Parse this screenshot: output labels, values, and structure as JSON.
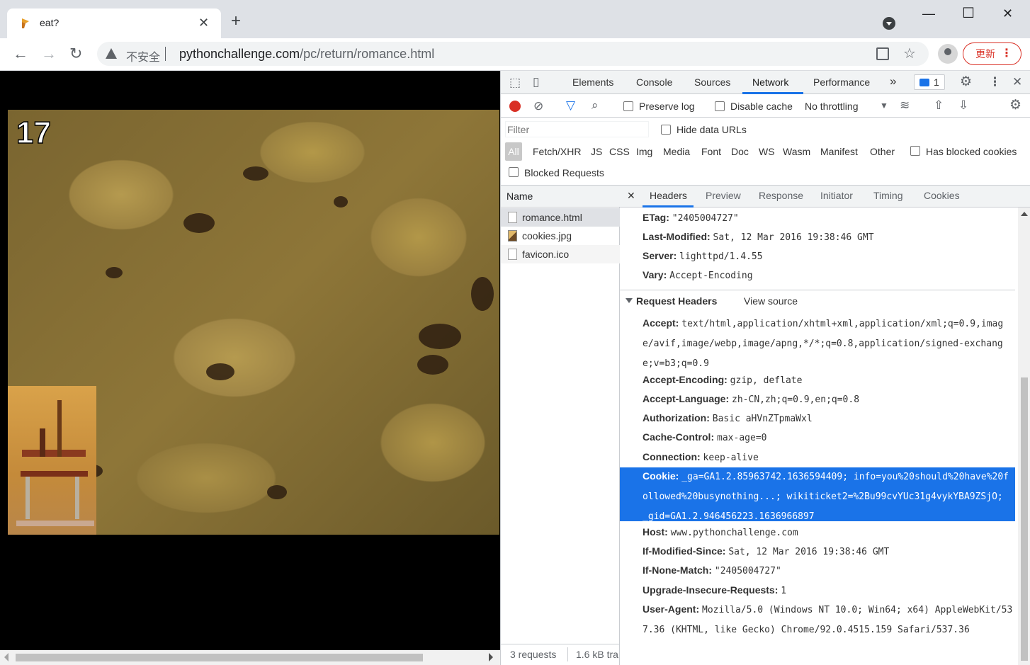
{
  "browser": {
    "tab_title": "eat?",
    "tab_close": "✕",
    "new_tab": "+",
    "window_minimize": "—",
    "window_maximize": "☐",
    "window_close": "✕",
    "insecure_label": "不安全",
    "url_host": "pythonchallenge.com",
    "url_path": "/pc/return/romance.html",
    "update_label": "更新",
    "icons": [
      "back-icon",
      "forward-icon",
      "reload-icon",
      "warning-icon",
      "qr-icon",
      "star-icon",
      "profile-icon",
      "menu-icon"
    ]
  },
  "page": {
    "level_number": "17"
  },
  "devtools": {
    "tabs": [
      "Elements",
      "Console",
      "Sources",
      "Network",
      "Performance"
    ],
    "active_tab": "Network",
    "more_tabs": "»",
    "message_count": "1",
    "toolbar": {
      "preserve_log": "Preserve log",
      "disable_cache": "Disable cache",
      "throttling": "No throttling"
    },
    "filter": {
      "placeholder": "Filter",
      "hide_data_urls": "Hide data URLs",
      "types": [
        "All",
        "Fetch/XHR",
        "JS",
        "CSS",
        "Img",
        "Media",
        "Font",
        "Doc",
        "WS",
        "Wasm",
        "Manifest",
        "Other"
      ],
      "has_blocked_cookies": "Has blocked cookies",
      "blocked_requests": "Blocked Requests"
    },
    "name_header": "Name",
    "requests": [
      {
        "name": "romance.html",
        "type": "doc"
      },
      {
        "name": "cookies.jpg",
        "type": "img"
      },
      {
        "name": "favicon.ico",
        "type": "doc"
      }
    ],
    "status": {
      "requests": "3 requests",
      "transferred": "1.6 kB tra"
    },
    "detail_tabs": [
      "Headers",
      "Preview",
      "Response",
      "Initiator",
      "Timing",
      "Cookies"
    ],
    "detail_close": "✕",
    "response_headers": [
      {
        "k": "ETag:",
        "v": "\"2405004727\""
      },
      {
        "k": "Last-Modified:",
        "v": "Sat, 12 Mar 2016 19:38:46 GMT"
      },
      {
        "k": "Server:",
        "v": "lighttpd/1.4.55"
      },
      {
        "k": "Vary:",
        "v": "Accept-Encoding"
      }
    ],
    "request_headers_title": "Request Headers",
    "view_source": "View source",
    "request_headers": [
      {
        "k": "Accept:",
        "v": "text/html,application/xhtml+xml,application/xml;q=0.9,image/avif,image/webp,image/apng,*/*;q=0.8,application/signed-exchange;v=b3;q=0.9"
      },
      {
        "k": "Accept-Encoding:",
        "v": "gzip, deflate"
      },
      {
        "k": "Accept-Language:",
        "v": "zh-CN,zh;q=0.9,en;q=0.8"
      },
      {
        "k": "Authorization:",
        "v": "Basic aHVnZTpmaWxl"
      },
      {
        "k": "Cache-Control:",
        "v": "max-age=0"
      },
      {
        "k": "Connection:",
        "v": "keep-alive"
      },
      {
        "k": "Cookie:",
        "v": "_ga=GA1.2.85963742.1636594409; info=you%20should%20have%20followed%20busynothing...; wikiticket2=%2Bu99cvYUc31g4vykYBA9ZSjO; _gid=GA1.2.946456223.1636966897"
      },
      {
        "k": "Host:",
        "v": "www.pythonchallenge.com"
      },
      {
        "k": "If-Modified-Since:",
        "v": "Sat, 12 Mar 2016 19:38:46 GMT"
      },
      {
        "k": "If-None-Match:",
        "v": "\"2405004727\""
      },
      {
        "k": "Upgrade-Insecure-Requests:",
        "v": "1"
      },
      {
        "k": "User-Agent:",
        "v": "Mozilla/5.0 (Windows NT 10.0; Win64; x64) AppleWebKit/537.36 (KHTML, like Gecko) Chrome/92.0.4515.159 Safari/537.36"
      }
    ],
    "selected_header": "Cookie:",
    "colors": {
      "accent": "#1a73e8",
      "record": "#d93025"
    }
  }
}
